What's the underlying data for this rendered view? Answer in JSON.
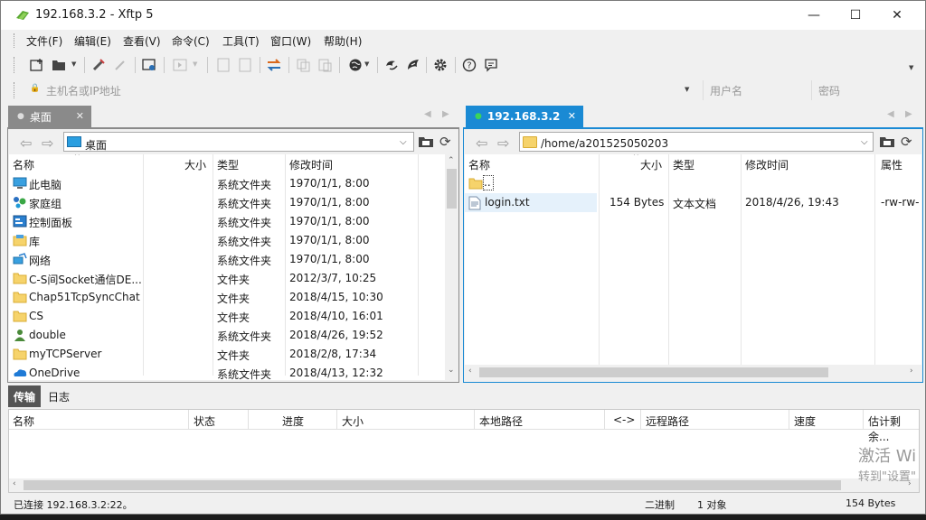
{
  "window": {
    "title": "192.168.3.2   - Xftp 5",
    "minimize": "—",
    "maximize": "☐",
    "close": "✕"
  },
  "menu": [
    "文件(F)",
    "编辑(E)",
    "查看(V)",
    "命令(C)",
    "工具(T)",
    "窗口(W)",
    "帮助(H)"
  ],
  "address": {
    "host_placeholder": "主机名或IP地址",
    "user_placeholder": "用户名",
    "password_placeholder": "密码"
  },
  "left_pane": {
    "tab_label": "桌面",
    "path": "桌面",
    "columns": [
      "名称",
      "大小",
      "类型",
      "修改时间"
    ],
    "rows": [
      {
        "name": "此电脑",
        "size": "",
        "type": "系统文件夹",
        "modified": "1970/1/1, 8:00",
        "icon": "computer-icon"
      },
      {
        "name": "家庭组",
        "size": "",
        "type": "系统文件夹",
        "modified": "1970/1/1, 8:00",
        "icon": "homegroup-icon"
      },
      {
        "name": "控制面板",
        "size": "",
        "type": "系统文件夹",
        "modified": "1970/1/1, 8:00",
        "icon": "control-panel-icon"
      },
      {
        "name": "库",
        "size": "",
        "type": "系统文件夹",
        "modified": "1970/1/1, 8:00",
        "icon": "library-icon"
      },
      {
        "name": "网络",
        "size": "",
        "type": "系统文件夹",
        "modified": "1970/1/1, 8:00",
        "icon": "network-icon"
      },
      {
        "name": "C-S间Socket通信DE...",
        "size": "",
        "type": "文件夹",
        "modified": "2012/3/7, 10:25",
        "icon": "folder-icon"
      },
      {
        "name": "Chap51TcpSyncChat",
        "size": "",
        "type": "文件夹",
        "modified": "2018/4/15, 10:30",
        "icon": "folder-icon"
      },
      {
        "name": "CS",
        "size": "",
        "type": "文件夹",
        "modified": "2018/4/10, 16:01",
        "icon": "folder-icon"
      },
      {
        "name": "double",
        "size": "",
        "type": "系统文件夹",
        "modified": "2018/4/26, 19:52",
        "icon": "user-icon"
      },
      {
        "name": "myTCPServer",
        "size": "",
        "type": "文件夹",
        "modified": "2018/2/8, 17:34",
        "icon": "folder-icon"
      },
      {
        "name": "OneDrive",
        "size": "",
        "type": "系统文件夹",
        "modified": "2018/4/13, 12:32",
        "icon": "onedrive-icon"
      }
    ]
  },
  "right_pane": {
    "tab_label": "192.168.3.2",
    "path": "/home/a201525050203",
    "columns": [
      "名称",
      "大小",
      "类型",
      "修改时间",
      "属性"
    ],
    "rows": [
      {
        "name": "..",
        "size": "",
        "type": "",
        "modified": "",
        "attr": "",
        "icon": "folder-up-icon"
      },
      {
        "name": "login.txt",
        "size": "154 Bytes",
        "type": "文本文档",
        "modified": "2018/4/26, 19:43",
        "attr": "-rw-rw-",
        "icon": "text-file-icon"
      }
    ]
  },
  "bottom": {
    "tabs": [
      "传输",
      "日志"
    ],
    "columns": [
      "名称",
      "状态",
      "进度",
      "大小",
      "本地路径",
      "<->",
      "远程路径",
      "速度",
      "估计剩余..."
    ]
  },
  "status": {
    "connection": "已连接 192.168.3.2:22。",
    "mode": "二进制",
    "objects": "1 对象",
    "size": "154 Bytes"
  },
  "watermark": {
    "line1": "激活 Wi",
    "line2": "转到\"设置\""
  },
  "colors": {
    "active_tab": "#1a8ad4",
    "inactive_tab": "#8a8a8a",
    "selection": "#e5f1fb"
  }
}
